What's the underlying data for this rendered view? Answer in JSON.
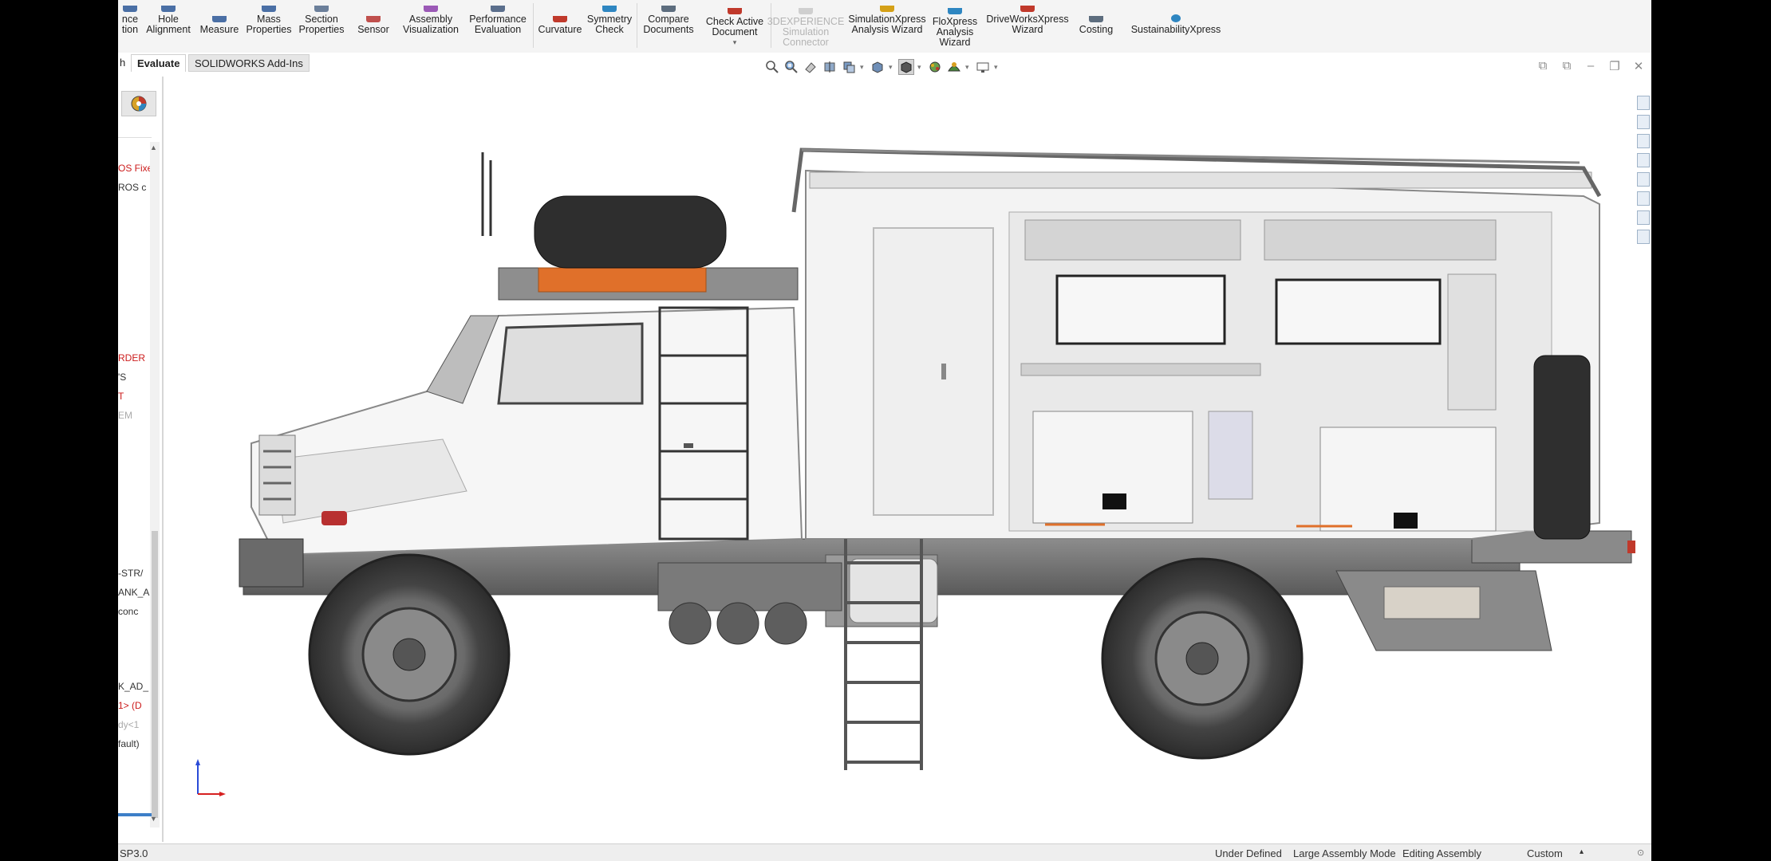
{
  "ribbon": {
    "buttons": [
      {
        "label": "nce\ntion",
        "icon": "interference-icon",
        "color": "#4a6fa5"
      },
      {
        "label": "Hole\nAlignment",
        "icon": "hole-alignment-icon",
        "color": "#4a6fa5"
      },
      {
        "label": "Measure",
        "icon": "measure-icon",
        "color": "#4a6fa5"
      },
      {
        "label": "Mass\nProperties",
        "icon": "mass-properties-icon",
        "color": "#4a6fa5"
      },
      {
        "label": "Section\nProperties",
        "icon": "section-properties-icon",
        "color": "#6b7f9a"
      },
      {
        "label": "Sensor",
        "icon": "sensor-icon",
        "color": "#c0504d"
      },
      {
        "label": "Assembly\nVisualization",
        "icon": "assembly-visualization-icon",
        "color": "#9b59b6"
      },
      {
        "label": "Performance\nEvaluation",
        "icon": "performance-evaluation-icon",
        "color": "#5a6e8c"
      },
      {
        "label": "Curvature",
        "icon": "curvature-icon",
        "color": "#c0392b"
      },
      {
        "label": "Symmetry\nCheck",
        "icon": "symmetry-check-icon",
        "color": "#2e86c1"
      },
      {
        "label": "Compare\nDocuments",
        "icon": "compare-documents-icon",
        "color": "#5d6d7e"
      },
      {
        "label": "Check Active\nDocument",
        "icon": "check-active-document-icon",
        "color": "#c0392b"
      },
      {
        "label": "3DEXPERIENCE\nSimulation\nConnector",
        "icon": "3dexperience-icon",
        "color": "#bbbbbb",
        "disabled": true
      },
      {
        "label": "SimulationXpress\nAnalysis Wizard",
        "icon": "simulationxpress-icon",
        "color": "#d4a017"
      },
      {
        "label": "FloXpress\nAnalysis\nWizard",
        "icon": "floxpress-icon",
        "color": "#2e86c1"
      },
      {
        "label": "DriveWorksXpress\nWizard",
        "icon": "driveworksxpress-icon",
        "color": "#c0392b"
      },
      {
        "label": "Costing",
        "icon": "costing-icon",
        "color": "#5d6d7e"
      },
      {
        "label": "SustainabilityXpress",
        "icon": "sustainabilityxpress-icon",
        "color": "#2e86c1"
      }
    ],
    "check_active_dropdown": "▾"
  },
  "tabs": {
    "partial": "h",
    "evaluate": "Evaluate",
    "addins": "SOLIDWORKS Add-Ins"
  },
  "view_toolbar": {
    "icons": [
      "zoom-to-fit-icon",
      "zoom-to-area-icon",
      "previous-view-icon",
      "section-view-icon",
      "dynamic-annotation-icon",
      "view-orientation-icon",
      "display-style-icon",
      "hide-show-items-icon",
      "edit-appearance-icon",
      "apply-scene-icon",
      "view-settings-icon"
    ]
  },
  "window_controls": {
    "a": "⧉",
    "b": "⧉",
    "min": "–",
    "restore": "❐",
    "close": "✕"
  },
  "feature_tree": {
    "items": [
      {
        "text": "OS Fixe",
        "style": "red"
      },
      {
        "text": "ROS c",
        "style": "normal"
      },
      {
        "text": "RDER",
        "style": "red"
      },
      {
        "text": "'S",
        "style": "normal"
      },
      {
        "text": "T",
        "style": "red"
      },
      {
        "text": "EM",
        "style": "gray"
      },
      {
        "text": "-STR/",
        "style": "normal"
      },
      {
        "text": "ANK_A",
        "style": "normal"
      },
      {
        "text": "conc",
        "style": "normal"
      },
      {
        "text": "K_AD_",
        "style": "normal"
      },
      {
        "text": "1> (D",
        "style": "red"
      },
      {
        "text": "dy<1",
        "style": "gray"
      },
      {
        "text": "fault)",
        "style": "normal"
      }
    ]
  },
  "status": {
    "version": "SP3.0",
    "definition": "Under Defined",
    "mode": "Large Assembly Mode",
    "editing": "Editing Assembly",
    "units": "Custom",
    "units_arrow": "▴"
  },
  "colors": {
    "accent_blue": "#3d7fc8",
    "tree_red": "#cc1b1b",
    "orange_part": "#e0702a",
    "triad_red": "#d62020",
    "triad_blue": "#2a4bd7"
  }
}
